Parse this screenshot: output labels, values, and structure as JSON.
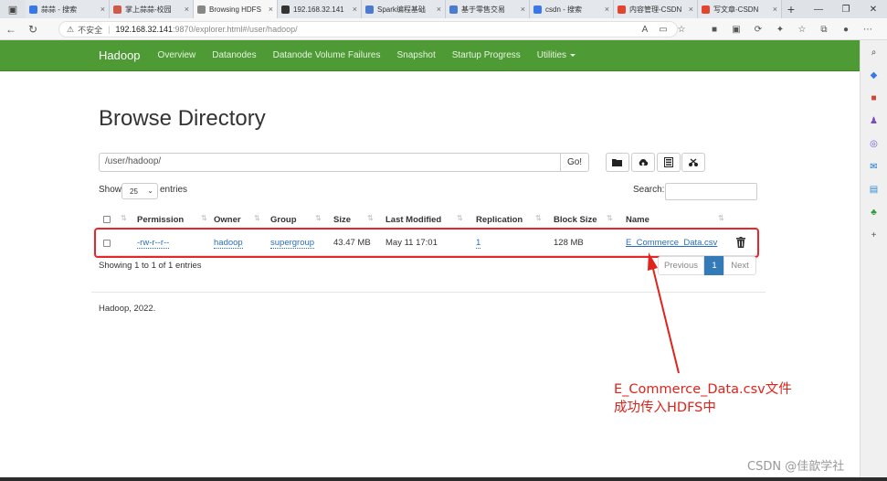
{
  "browser": {
    "tabs": [
      {
        "label": "蒜蒜 - 搜索",
        "color": "#3b78e7",
        "active": false
      },
      {
        "label": "掌上蒜蒜-校园",
        "color": "#d05a4a",
        "active": false
      },
      {
        "label": "Browsing HDFS",
        "color": "#888888",
        "active": true
      },
      {
        "label": "192.168.32.141",
        "color": "#333333",
        "active": false
      },
      {
        "label": "Spark编程基础",
        "color": "#4a7bd0",
        "active": false
      },
      {
        "label": "基于零售交易",
        "color": "#4a7bd0",
        "active": false
      },
      {
        "label": "csdn - 搜索",
        "color": "#3b78e7",
        "active": false
      },
      {
        "label": "内容管理-CSDN",
        "color": "#e2452f",
        "active": false
      },
      {
        "label": "写文章-CSDN",
        "color": "#e2452f",
        "active": false
      }
    ],
    "address": {
      "security": "不安全",
      "host": "192.168.32.141",
      "path": ":9870/explorer.html#/user/hadoop/"
    }
  },
  "navbar": {
    "brand": "Hadoop",
    "items": [
      "Overview",
      "Datanodes",
      "Datanode Volume Failures",
      "Snapshot",
      "Startup Progress",
      "Utilities"
    ]
  },
  "page": {
    "title": "Browse Directory",
    "directory": "/user/hadoop/",
    "go_label": "Go!",
    "show_label": "Show",
    "show_value": "25",
    "entries_label": "entries",
    "search_label": "Search:",
    "search_value": ""
  },
  "table": {
    "headers": [
      "Permission",
      "Owner",
      "Group",
      "Size",
      "Last Modified",
      "Replication",
      "Block Size",
      "Name"
    ],
    "rows": [
      {
        "permission": "-rw-r--r--",
        "owner": "hadoop",
        "group": "supergroup",
        "size": "43.47 MB",
        "last_modified": "May 11 17:01",
        "replication": "1",
        "block_size": "128 MB",
        "name": "E_Commerce_Data.csv"
      }
    ],
    "showing": "Showing 1 to 1 of 1 entries",
    "pager": {
      "previous": "Previous",
      "current": "1",
      "next": "Next"
    }
  },
  "footer": "Hadoop, 2022.",
  "annotation": {
    "line1": "E_Commerce_Data.csv文件",
    "line2": "成功传入HDFS中",
    "color": "#e0231b"
  },
  "watermark": "CSDN @佳歆学社"
}
